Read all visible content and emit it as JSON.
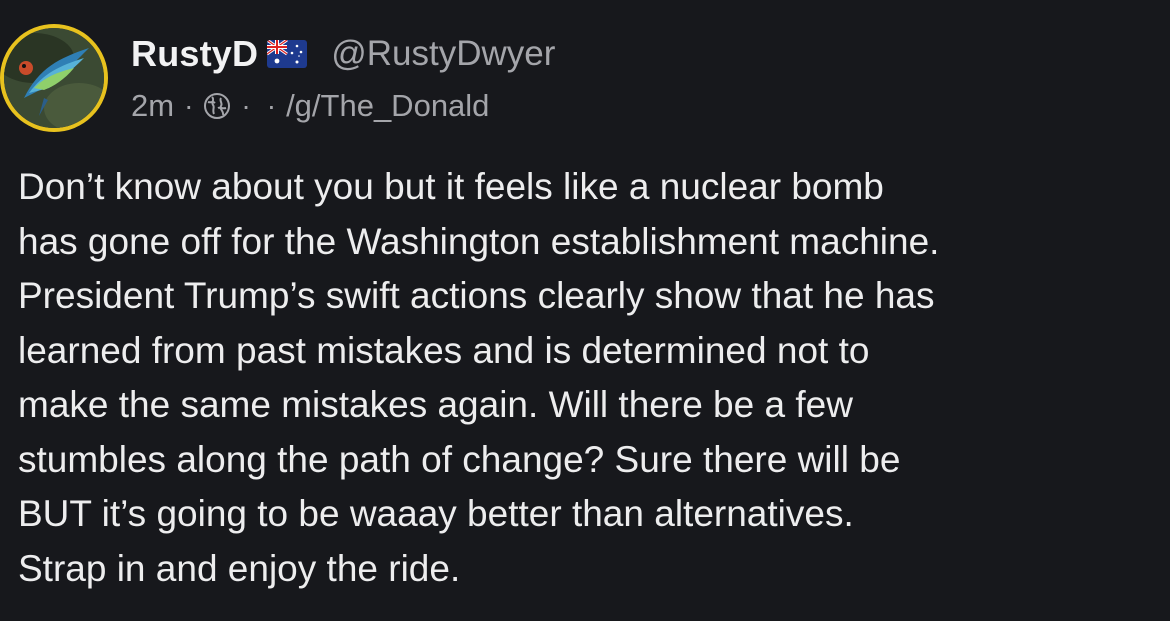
{
  "post": {
    "author": {
      "display_name": "RustyD",
      "flag_icon": "australia-flag-icon",
      "handle": "@RustyDwyer"
    },
    "meta": {
      "time": "2m",
      "separator": "·",
      "visibility_icon": "globe-icon",
      "extra_separator": "·",
      "community": "/g/The_Donald"
    },
    "body_lines": [
      "Don’t know about you but it feels like a nuclear bomb",
      "has gone off for the Washington establishment machine.",
      "President Trump’s swift actions clearly show that he has",
      "learned from past mistakes and is determined not to",
      "make the same mistakes again. Will there be a few",
      "stumbles along the path of change? Sure there will be",
      "BUT it’s going to be waaay better than alternatives.",
      "Strap in and enjoy the ride."
    ]
  },
  "colors": {
    "background": "#17181c",
    "avatar_ring": "#e8c21e",
    "primary_text": "#ededee",
    "secondary_text": "#a4a5aa"
  }
}
